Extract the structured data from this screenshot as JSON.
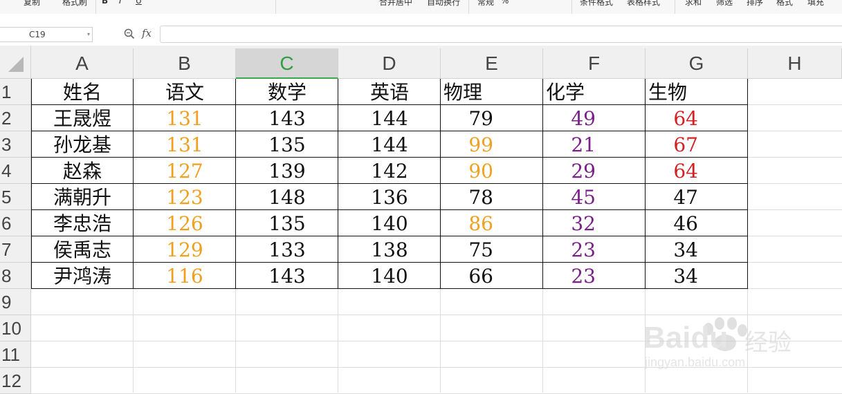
{
  "toolbar": {
    "items": [
      "复制",
      "格式刷",
      "B",
      "I",
      "U",
      "合并居中",
      "自动换行",
      "常规",
      "%",
      "条件格式",
      "表格样式",
      "求和",
      "筛选",
      "排序",
      "格式",
      "填充"
    ]
  },
  "formula_bar": {
    "cell_ref": "C19",
    "fx_label": "fx",
    "formula": ""
  },
  "columns": [
    "A",
    "B",
    "C",
    "D",
    "E",
    "F",
    "G",
    "H"
  ],
  "selected_column": "C",
  "rows": [
    "1",
    "2",
    "3",
    "4",
    "5",
    "6",
    "7",
    "8",
    "9",
    "10",
    "11",
    "12"
  ],
  "table": {
    "headers": [
      "姓名",
      "语文",
      "数学",
      "英语",
      "物理",
      "化学",
      "生物"
    ],
    "records": [
      [
        "王晟煜",
        "131",
        "143",
        "144",
        "79",
        "49",
        "64"
      ],
      [
        "孙龙基",
        "131",
        "135",
        "144",
        "99",
        "21",
        "67"
      ],
      [
        "赵森",
        "127",
        "139",
        "142",
        "90",
        "29",
        "64"
      ],
      [
        "满朝升",
        "123",
        "148",
        "136",
        "78",
        "45",
        "47"
      ],
      [
        "李忠浩",
        "126",
        "135",
        "140",
        "86",
        "32",
        "46"
      ],
      [
        "侯禹志",
        "129",
        "133",
        "138",
        "75",
        "23",
        "34"
      ],
      [
        "尹鸿涛",
        "116",
        "143",
        "140",
        "66",
        "23",
        "34"
      ]
    ],
    "colors": {
      "default": "#111111",
      "orange": "#f0a020",
      "purple": "#7a1f8a",
      "red": "#d42020"
    }
  },
  "watermark": {
    "brand": "Baidu",
    "brand_cn": "经验",
    "url": "jingyan.baidu.com"
  }
}
